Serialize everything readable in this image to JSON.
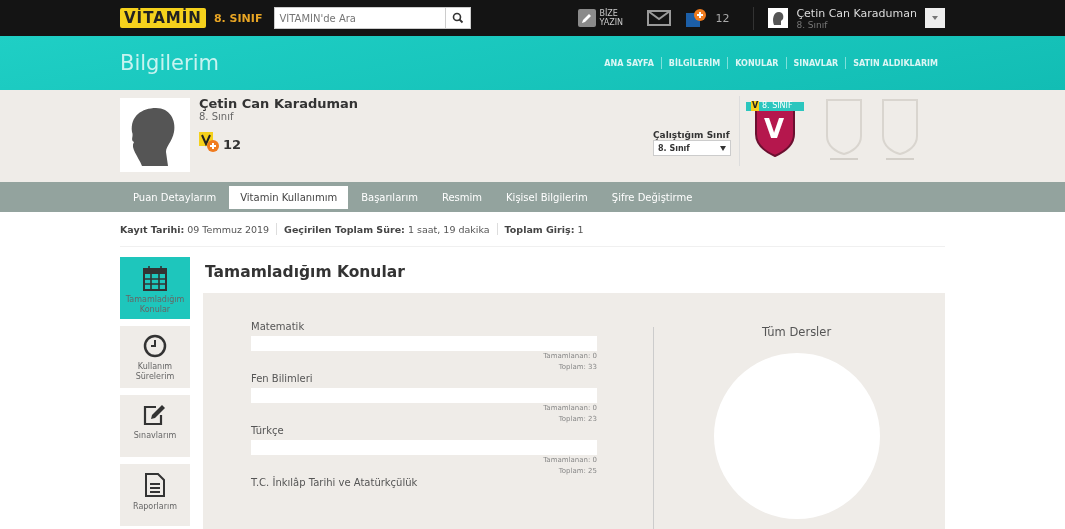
{
  "topbar": {
    "logo": "VİTAMİN",
    "grade": "8. SINIF",
    "search": {
      "placeholder": "VİTAMİN'de Ara"
    },
    "write_us": "BİZE YAZIN",
    "points": "12",
    "user": {
      "name": "Çetin Can Karaduman",
      "grade": "8. Sınıf"
    }
  },
  "header": {
    "title": "Bilgilerim",
    "nav": [
      {
        "label": "ANA SAYFA"
      },
      {
        "label": "BİLGİLERİM"
      },
      {
        "label": "KONULAR"
      },
      {
        "label": "SINAVLAR"
      },
      {
        "label": "SATIN ALDIKLARIM"
      }
    ]
  },
  "profile": {
    "name": "Çetin Can Karaduman",
    "grade": "8. Sınıf",
    "points": "12",
    "class_label": "Çalıştığım Sınıf",
    "class_value": "8. Sınıf",
    "badges": [
      {
        "earned": true,
        "logo": "V",
        "ribbon": "8. SINIF",
        "letter": "V"
      },
      {
        "earned": false
      },
      {
        "earned": false
      }
    ]
  },
  "tabs": [
    {
      "label": "Puan Detaylarım",
      "selected": false
    },
    {
      "label": "Vitamin Kullanımım",
      "selected": true
    },
    {
      "label": "Başarılarım",
      "selected": false
    },
    {
      "label": "Resmim",
      "selected": false
    },
    {
      "label": "Kişisel Bilgilerim",
      "selected": false
    },
    {
      "label": "Şifre Değiştirme",
      "selected": false
    }
  ],
  "stats": [
    {
      "label": "Kayıt Tarihi:",
      "value": "09 Temmuz 2019"
    },
    {
      "label": "Geçirilen Toplam Süre:",
      "value": "1 saat, 19 dakika"
    },
    {
      "label": "Toplam Giriş:",
      "value": "1"
    }
  ],
  "sidebar": [
    {
      "kind": "calendar",
      "label": "Tamamladığım Konular",
      "selected": true
    },
    {
      "kind": "clock",
      "label": "Kullanım Sürelerim",
      "selected": false
    },
    {
      "kind": "edit",
      "label": "Sınavlarım",
      "selected": false
    },
    {
      "kind": "report",
      "label": "Raporlarım",
      "selected": false
    }
  ],
  "section_title": "Tamamladığım Konular",
  "subjects": [
    {
      "name": "Matematik",
      "level": 0,
      "completed": "Tamamlanan: 0",
      "total": "Toplam: 33"
    },
    {
      "name": "Fen Bilimleri",
      "level": 0,
      "completed": "Tamamlanan: 0",
      "total": "Toplam: 23"
    },
    {
      "name": "Türkçe",
      "level": 0,
      "completed": "Tamamlanan: 0",
      "total": "Toplam: 25"
    },
    {
      "name": "T.C. İnkılâp Tarihi ve Atatürkçülük"
    }
  ],
  "all_title": "Tüm Dersler"
}
